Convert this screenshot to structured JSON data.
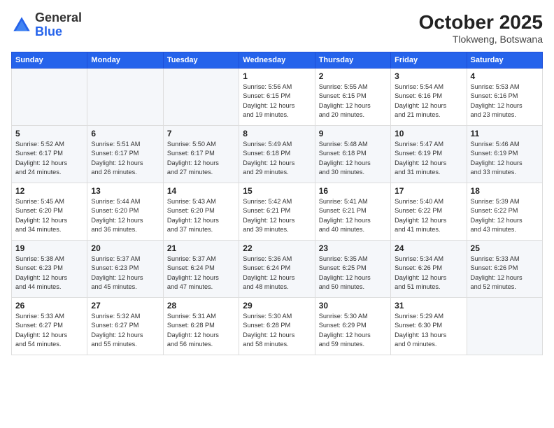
{
  "header": {
    "logo_general": "General",
    "logo_blue": "Blue",
    "month": "October 2025",
    "location": "Tlokweng, Botswana"
  },
  "days_of_week": [
    "Sunday",
    "Monday",
    "Tuesday",
    "Wednesday",
    "Thursday",
    "Friday",
    "Saturday"
  ],
  "weeks": [
    [
      {
        "day": "",
        "info": ""
      },
      {
        "day": "",
        "info": ""
      },
      {
        "day": "",
        "info": ""
      },
      {
        "day": "1",
        "info": "Sunrise: 5:56 AM\nSunset: 6:15 PM\nDaylight: 12 hours\nand 19 minutes."
      },
      {
        "day": "2",
        "info": "Sunrise: 5:55 AM\nSunset: 6:15 PM\nDaylight: 12 hours\nand 20 minutes."
      },
      {
        "day": "3",
        "info": "Sunrise: 5:54 AM\nSunset: 6:16 PM\nDaylight: 12 hours\nand 21 minutes."
      },
      {
        "day": "4",
        "info": "Sunrise: 5:53 AM\nSunset: 6:16 PM\nDaylight: 12 hours\nand 23 minutes."
      }
    ],
    [
      {
        "day": "5",
        "info": "Sunrise: 5:52 AM\nSunset: 6:17 PM\nDaylight: 12 hours\nand 24 minutes."
      },
      {
        "day": "6",
        "info": "Sunrise: 5:51 AM\nSunset: 6:17 PM\nDaylight: 12 hours\nand 26 minutes."
      },
      {
        "day": "7",
        "info": "Sunrise: 5:50 AM\nSunset: 6:17 PM\nDaylight: 12 hours\nand 27 minutes."
      },
      {
        "day": "8",
        "info": "Sunrise: 5:49 AM\nSunset: 6:18 PM\nDaylight: 12 hours\nand 29 minutes."
      },
      {
        "day": "9",
        "info": "Sunrise: 5:48 AM\nSunset: 6:18 PM\nDaylight: 12 hours\nand 30 minutes."
      },
      {
        "day": "10",
        "info": "Sunrise: 5:47 AM\nSunset: 6:19 PM\nDaylight: 12 hours\nand 31 minutes."
      },
      {
        "day": "11",
        "info": "Sunrise: 5:46 AM\nSunset: 6:19 PM\nDaylight: 12 hours\nand 33 minutes."
      }
    ],
    [
      {
        "day": "12",
        "info": "Sunrise: 5:45 AM\nSunset: 6:20 PM\nDaylight: 12 hours\nand 34 minutes."
      },
      {
        "day": "13",
        "info": "Sunrise: 5:44 AM\nSunset: 6:20 PM\nDaylight: 12 hours\nand 36 minutes."
      },
      {
        "day": "14",
        "info": "Sunrise: 5:43 AM\nSunset: 6:20 PM\nDaylight: 12 hours\nand 37 minutes."
      },
      {
        "day": "15",
        "info": "Sunrise: 5:42 AM\nSunset: 6:21 PM\nDaylight: 12 hours\nand 39 minutes."
      },
      {
        "day": "16",
        "info": "Sunrise: 5:41 AM\nSunset: 6:21 PM\nDaylight: 12 hours\nand 40 minutes."
      },
      {
        "day": "17",
        "info": "Sunrise: 5:40 AM\nSunset: 6:22 PM\nDaylight: 12 hours\nand 41 minutes."
      },
      {
        "day": "18",
        "info": "Sunrise: 5:39 AM\nSunset: 6:22 PM\nDaylight: 12 hours\nand 43 minutes."
      }
    ],
    [
      {
        "day": "19",
        "info": "Sunrise: 5:38 AM\nSunset: 6:23 PM\nDaylight: 12 hours\nand 44 minutes."
      },
      {
        "day": "20",
        "info": "Sunrise: 5:37 AM\nSunset: 6:23 PM\nDaylight: 12 hours\nand 45 minutes."
      },
      {
        "day": "21",
        "info": "Sunrise: 5:37 AM\nSunset: 6:24 PM\nDaylight: 12 hours\nand 47 minutes."
      },
      {
        "day": "22",
        "info": "Sunrise: 5:36 AM\nSunset: 6:24 PM\nDaylight: 12 hours\nand 48 minutes."
      },
      {
        "day": "23",
        "info": "Sunrise: 5:35 AM\nSunset: 6:25 PM\nDaylight: 12 hours\nand 50 minutes."
      },
      {
        "day": "24",
        "info": "Sunrise: 5:34 AM\nSunset: 6:26 PM\nDaylight: 12 hours\nand 51 minutes."
      },
      {
        "day": "25",
        "info": "Sunrise: 5:33 AM\nSunset: 6:26 PM\nDaylight: 12 hours\nand 52 minutes."
      }
    ],
    [
      {
        "day": "26",
        "info": "Sunrise: 5:33 AM\nSunset: 6:27 PM\nDaylight: 12 hours\nand 54 minutes."
      },
      {
        "day": "27",
        "info": "Sunrise: 5:32 AM\nSunset: 6:27 PM\nDaylight: 12 hours\nand 55 minutes."
      },
      {
        "day": "28",
        "info": "Sunrise: 5:31 AM\nSunset: 6:28 PM\nDaylight: 12 hours\nand 56 minutes."
      },
      {
        "day": "29",
        "info": "Sunrise: 5:30 AM\nSunset: 6:28 PM\nDaylight: 12 hours\nand 58 minutes."
      },
      {
        "day": "30",
        "info": "Sunrise: 5:30 AM\nSunset: 6:29 PM\nDaylight: 12 hours\nand 59 minutes."
      },
      {
        "day": "31",
        "info": "Sunrise: 5:29 AM\nSunset: 6:30 PM\nDaylight: 13 hours\nand 0 minutes."
      },
      {
        "day": "",
        "info": ""
      }
    ]
  ]
}
